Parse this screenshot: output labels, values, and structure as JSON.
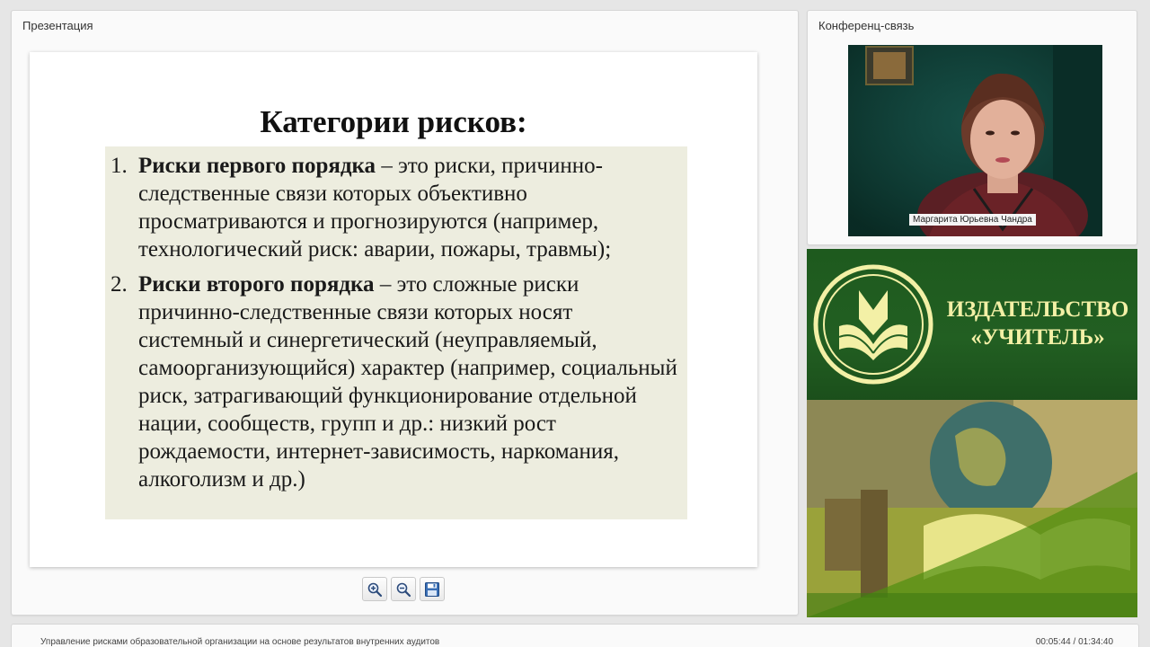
{
  "presentation": {
    "title": "Презентация",
    "slide": {
      "heading": "Категории рисков:",
      "items": [
        {
          "number": "1.",
          "term": "Риски первого порядка",
          "text": " – это риски, причинно-следственные связи которых объективно просматриваются и прогнозируются (например, технологический риск: аварии, пожары, травмы);"
        },
        {
          "number": "2.",
          "term": "Риски второго порядка",
          "text": " – это сложные риски причинно-следственные связи которых носят системный и синергетический (неуправляемый, самоорганизующийся) характер (например, социальный риск, затрагивающий функционирование отдельной нации, сообществ, групп и др.: низкий рост рождаемости, интернет-зависимость, наркомания, алкоголизм и др.)"
        }
      ]
    },
    "toolbar": {
      "zoom_in_icon": "zoom-in-icon",
      "zoom_out_icon": "zoom-out-icon",
      "save_icon": "floppy-disk-icon"
    }
  },
  "conference": {
    "title": "Конференц-связь",
    "speaker_name": "Маргарита Юрьевна Чандра"
  },
  "banner": {
    "line1": "ИЗДАТЕЛЬСТВО",
    "line2": "«УЧИТЕЛЬ»",
    "colors": {
      "green": "#225f22",
      "text": "#f3f0a6"
    }
  },
  "bottombar": {
    "course_title": "Управление рисками образовательной организации на основе результатов внутренних аудитов",
    "time": "00:05:44 / 01:34:40"
  }
}
